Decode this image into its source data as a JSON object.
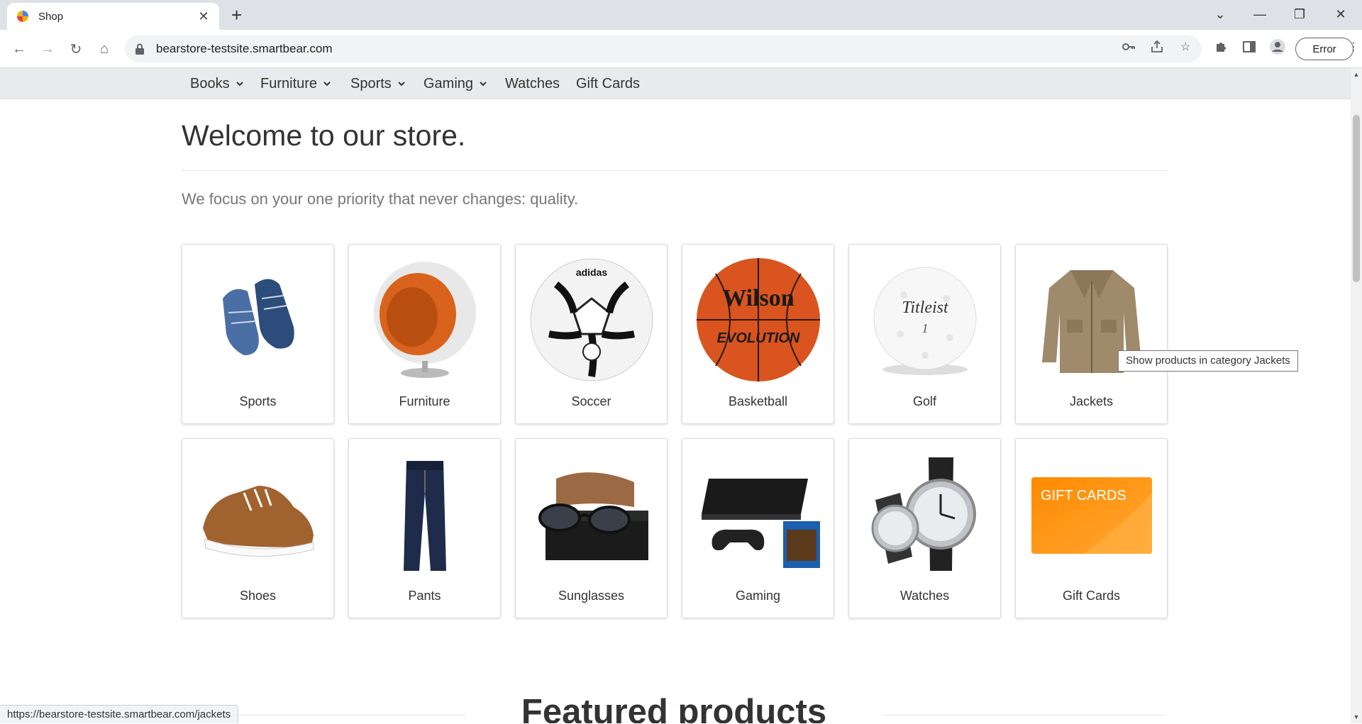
{
  "browser": {
    "tab_title": "Shop",
    "url": "bearstore-testsite.smartbear.com",
    "profile_error_label": "Error",
    "status_url": "https://bearstore-testsite.smartbear.com/jackets"
  },
  "nav": {
    "items": [
      {
        "label": "Books",
        "has_dropdown": true
      },
      {
        "label": "Furniture",
        "has_dropdown": true
      },
      {
        "label": "Sports",
        "has_dropdown": true
      },
      {
        "label": "Gaming",
        "has_dropdown": true
      },
      {
        "label": "Watches",
        "has_dropdown": false
      },
      {
        "label": "Gift Cards",
        "has_dropdown": false
      }
    ]
  },
  "page": {
    "welcome_title": "Welcome to our store.",
    "tagline": "We focus on your one priority that never changes: quality.",
    "categories": [
      {
        "label": "Sports",
        "icon": "sneakers-image"
      },
      {
        "label": "Furniture",
        "icon": "ball-chair-image"
      },
      {
        "label": "Soccer",
        "icon": "soccer-ball-image"
      },
      {
        "label": "Basketball",
        "icon": "basketball-image"
      },
      {
        "label": "Golf",
        "icon": "golf-ball-image"
      },
      {
        "label": "Jackets",
        "icon": "jacket-image"
      },
      {
        "label": "Shoes",
        "icon": "shoe-image"
      },
      {
        "label": "Pants",
        "icon": "jeans-image"
      },
      {
        "label": "Sunglasses",
        "icon": "sunglasses-image"
      },
      {
        "label": "Gaming",
        "icon": "console-image"
      },
      {
        "label": "Watches",
        "icon": "watches-image"
      },
      {
        "label": "Gift Cards",
        "icon": "gift-card-image"
      }
    ],
    "tooltip": "Show products in category Jackets",
    "featured_title": "Featured products",
    "logo_text": {
      "wilson": "Wilson",
      "evolution": "EVOLUTION",
      "titleist": "Titleist",
      "titleist_num": "1",
      "giftcard": "GIFT CARDS"
    }
  },
  "colors": {
    "nav_bg": "#e8eaed",
    "giftcard_orange": "#ff8a00",
    "basketball": "#d9541e"
  }
}
